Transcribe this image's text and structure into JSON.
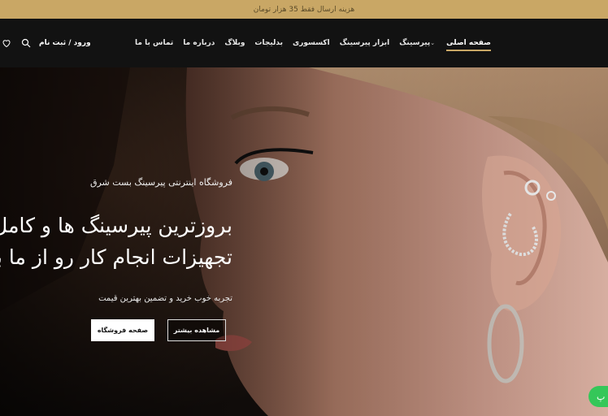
{
  "announcement": "هزینه ارسال فقط 35 هزار تومان",
  "nav": {
    "items": [
      {
        "label": "صفحه اصلی",
        "active": true
      },
      {
        "label": "پیرسینگ",
        "caret": "⌄"
      },
      {
        "label": "ابزار پیرسینگ"
      },
      {
        "label": "اکسسوری"
      },
      {
        "label": "بدلیجات"
      },
      {
        "label": "وبلاگ"
      },
      {
        "label": "درباره ما"
      },
      {
        "label": "تماس با ما"
      }
    ],
    "login": "ورود / ثبت نام",
    "icons": [
      "search-icon",
      "heart-icon"
    ]
  },
  "hero": {
    "subtitle": "فروشگاه اینترنتی پیرسینگ بست شرق",
    "title_line1": "بروزترین پیرسینگ ها و کامل ترین",
    "title_line2": "تجهیزات انجام کار رو از ما بخواهید",
    "tagline": "تجربه خوب خرید و تضمین بهترین قیمت",
    "btn_shop": "صفحه فروشگاه",
    "btn_more": "مشاهده بیشتر"
  },
  "chat": {
    "icon": "chat-icon",
    "label": "پ"
  },
  "colors": {
    "accent": "#c9a765",
    "header_bg": "#121212",
    "chat": "#35c759"
  }
}
